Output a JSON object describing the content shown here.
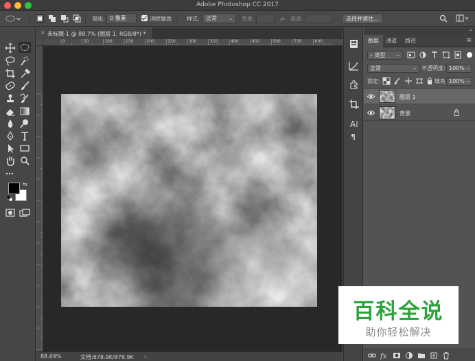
{
  "window": {
    "title": "Adobe Photoshop CC 2017"
  },
  "options_bar": {
    "feather_label": "羽化:",
    "feather_value": "0 像素",
    "antialias_label": "消除锯齿",
    "style_label": "样式:",
    "style_value": "正常",
    "width_label": "宽度:",
    "height_label": "高度:",
    "select_and_mask": "选择并遮住..."
  },
  "document": {
    "tab_title": "未标题-1 @ 88.7% (图层 1, RGB/8*) *",
    "close_glyph": "×"
  },
  "ruler": {
    "top_labels": [
      "0",
      "50",
      "100",
      "150",
      "200",
      "250",
      "300",
      "350",
      "400",
      "450",
      "500",
      "550",
      "600"
    ]
  },
  "status_bar": {
    "zoom": "88.69%",
    "doc_info": "文档:878.9K/878.9K",
    "arrow": "›"
  },
  "layers_panel": {
    "tabs": [
      "图层",
      "通道",
      "路径"
    ],
    "kind_filter": "类型",
    "blend_mode": "正常",
    "opacity_label": "不透明度:",
    "opacity_value": "100%",
    "lock_label": "锁定:",
    "fill_label": "填充:",
    "fill_value": "100%",
    "layers": [
      {
        "name": "图层 1",
        "selected": true,
        "locked": false
      },
      {
        "name": "背景",
        "selected": false,
        "locked": true
      }
    ]
  },
  "watermark": {
    "title": "百科全说",
    "subtitle": "助你轻松解决"
  },
  "colors": {
    "app_bg": "#535353",
    "workspace": "#282828",
    "watermark_green": "#2aa539"
  }
}
